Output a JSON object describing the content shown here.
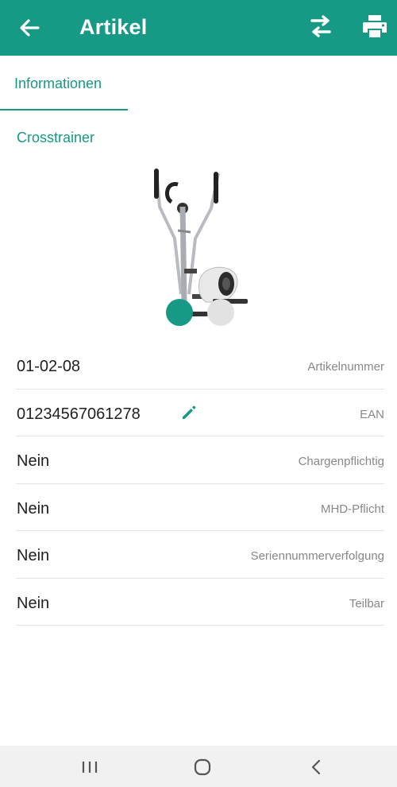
{
  "appbar": {
    "title": "Artikel",
    "back_icon": "arrow-back-icon",
    "actions": [
      "swap-icon",
      "print-icon"
    ],
    "color": "#169985"
  },
  "tabs": [
    {
      "label": "Informationen",
      "active": true
    }
  ],
  "product": {
    "name": "Crosstrainer",
    "image": "crosstrainer-image"
  },
  "details": [
    {
      "value": "01-02-08",
      "label": "Artikelnummer"
    },
    {
      "value": "01234567061278",
      "label": "EAN",
      "editable": true
    },
    {
      "value": "Nein",
      "label": "Chargenpflichtig"
    },
    {
      "value": "Nein",
      "label": "MHD-Pflicht"
    },
    {
      "value": "Nein",
      "label": "Seriennummerverfolgung"
    },
    {
      "value": "Nein",
      "label": "Teilbar"
    }
  ],
  "navbar": {
    "buttons": [
      "recent-apps-icon",
      "home-icon",
      "back-chevron-icon"
    ]
  }
}
